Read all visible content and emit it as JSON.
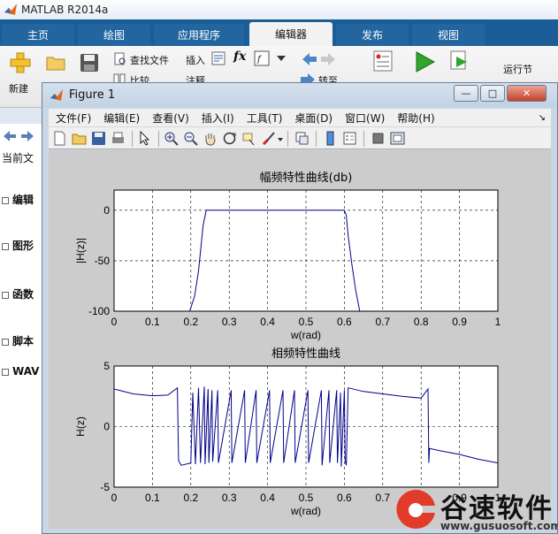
{
  "app": {
    "title": "MATLAB R2014a"
  },
  "tabs": [
    "主页",
    "绘图",
    "应用程序",
    "编辑器",
    "发布",
    "视图"
  ],
  "active_tab": "编辑器",
  "ribbon": {
    "new_label": "新建",
    "find_files": "查找文件",
    "compare": "比较",
    "insert": "插入",
    "comment": "注释",
    "goto": "转至",
    "run_section": "运行节"
  },
  "left_panel": {
    "current_folder": "当前文",
    "items": [
      "编辑",
      "图形",
      "函数",
      "脚本",
      "WAV"
    ]
  },
  "figure": {
    "title": "Figure 1",
    "menu": [
      "文件(F)",
      "编辑(E)",
      "查看(V)",
      "插入(I)",
      "工具(T)",
      "桌面(D)",
      "窗口(W)",
      "帮助(H)"
    ]
  },
  "chart_data": [
    {
      "type": "line",
      "title": "幅频特性曲线(db)",
      "xlabel": "w(rad)",
      "ylabel": "|H(z)|",
      "xlim": [
        0,
        1
      ],
      "ylim": [
        -100,
        20
      ],
      "xticks": [
        "0",
        "0.1",
        "0.2",
        "0.3",
        "0.4",
        "0.5",
        "0.6",
        "0.7",
        "0.8",
        "0.9",
        "1"
      ],
      "yticks": [
        "0",
        "-50",
        "-100"
      ],
      "grid": true,
      "series": [
        {
          "color": "#00008b",
          "x": [
            0.197,
            0.21,
            0.22,
            0.232,
            0.24,
            0.26,
            0.3,
            0.35,
            0.4,
            0.45,
            0.5,
            0.55,
            0.58,
            0.6,
            0.605,
            0.61,
            0.62,
            0.63,
            0.64
          ],
          "y": [
            -100,
            -85,
            -60,
            -15,
            0,
            0,
            0,
            0,
            0,
            0,
            0,
            0,
            0,
            0,
            -5,
            -25,
            -55,
            -80,
            -100
          ]
        }
      ]
    },
    {
      "type": "line",
      "title": "相频特性曲线",
      "xlabel": "w(rad)",
      "ylabel": "H(z)",
      "xlim": [
        0,
        1
      ],
      "ylim": [
        -5,
        5
      ],
      "xticks": [
        "0",
        "0.1",
        "0.2",
        "0.3",
        "0.4",
        "0.5",
        "0.6",
        "0.7",
        "0.8",
        "0.9",
        "1"
      ],
      "yticks": [
        "5",
        "0",
        "-5"
      ],
      "grid": true,
      "series": [
        {
          "color": "#00008b",
          "x": [
            0.0,
            0.05,
            0.1,
            0.14,
            0.165,
            0.168,
            0.175,
            0.2,
            0.205,
            0.212,
            0.22,
            0.225,
            0.235,
            0.237,
            0.245,
            0.247,
            0.255,
            0.257,
            0.27,
            0.272,
            0.305,
            0.307,
            0.34,
            0.342,
            0.37,
            0.372,
            0.405,
            0.407,
            0.44,
            0.442,
            0.47,
            0.472,
            0.505,
            0.507,
            0.54,
            0.542,
            0.56,
            0.562,
            0.58,
            0.582,
            0.59,
            0.592,
            0.6,
            0.602,
            0.605,
            0.61,
            0.65,
            0.7,
            0.75,
            0.8,
            0.818,
            0.82,
            0.822,
            0.85,
            0.9,
            0.95,
            1.0
          ],
          "y": [
            3.1,
            2.7,
            2.55,
            2.6,
            3.2,
            -2.8,
            -3.2,
            -3.0,
            2.8,
            -3.1,
            3.2,
            -3.0,
            3.3,
            -3.1,
            3.1,
            -3.0,
            3.0,
            -2.9,
            3.0,
            -3.0,
            3.0,
            -3.0,
            3.0,
            -3.0,
            3.0,
            -3.0,
            3.0,
            -3.0,
            3.0,
            -3.0,
            3.0,
            -3.0,
            3.0,
            -3.0,
            3.0,
            -3.2,
            3.0,
            -3.0,
            3.0,
            -3.0,
            2.8,
            -3.3,
            3.0,
            -2.8,
            -3.2,
            3.2,
            2.9,
            2.7,
            2.5,
            2.35,
            3.1,
            -3.0,
            -1.8,
            -2.0,
            -2.3,
            -2.7,
            -3.0
          ]
        }
      ]
    }
  ],
  "watermark": {
    "brand": "谷速软件",
    "url": "www.gusuosoft.com"
  },
  "colors": {
    "tabstrip": "#1a5d97",
    "plot_line": "#00008b",
    "figure_bg": "#cccccc"
  }
}
